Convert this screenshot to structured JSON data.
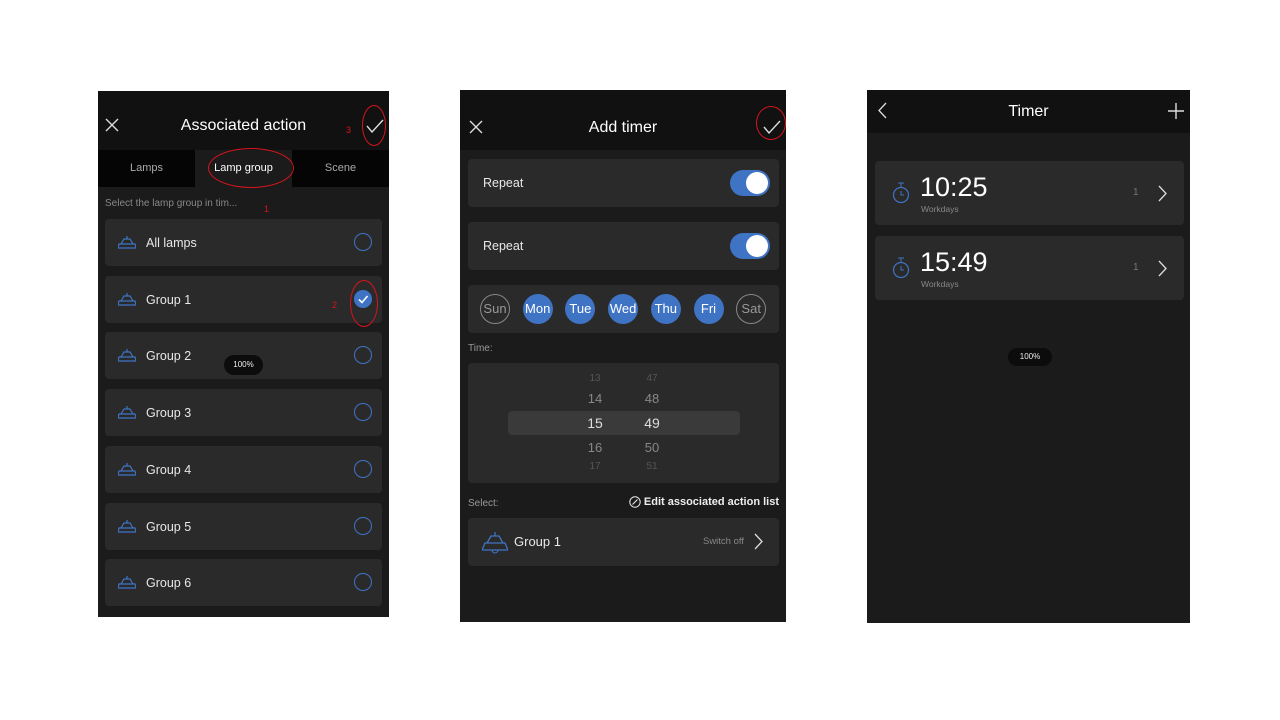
{
  "screen1": {
    "title": "Associated action",
    "tabs": [
      "Lamps",
      "Lamp group",
      "Scene"
    ],
    "selected_tab": "Lamp group",
    "hint": "Select the lamp group in tim...",
    "items": [
      {
        "label": "All lamps",
        "selected": false
      },
      {
        "label": "Group 1",
        "selected": true
      },
      {
        "label": "Group 2",
        "selected": false
      },
      {
        "label": "Group 3",
        "selected": false
      },
      {
        "label": "Group 4",
        "selected": false
      },
      {
        "label": "Group 5",
        "selected": false
      },
      {
        "label": "Group 6",
        "selected": false
      }
    ],
    "toast": "100%",
    "annotations": [
      "1",
      "2",
      "3"
    ]
  },
  "screen2": {
    "title": "Add timer",
    "toggles": [
      {
        "label": "Repeat",
        "on": true
      },
      {
        "label": "Repeat",
        "on": true
      }
    ],
    "days": [
      {
        "d": "Sun",
        "on": false
      },
      {
        "d": "Mon",
        "on": true
      },
      {
        "d": "Tue",
        "on": true
      },
      {
        "d": "Wed",
        "on": true
      },
      {
        "d": "Thu",
        "on": true
      },
      {
        "d": "Fri",
        "on": true
      },
      {
        "d": "Sat",
        "on": false
      }
    ],
    "time_label": "Time:",
    "hours": [
      "13",
      "14",
      "15",
      "16",
      "17"
    ],
    "minutes": [
      "47",
      "48",
      "49",
      "50",
      "51"
    ],
    "select_label": "Select:",
    "edit_link": "Edit associated action list",
    "group": {
      "label": "Group 1",
      "action": "Switch off"
    }
  },
  "screen3": {
    "title": "Timer",
    "timers": [
      {
        "time": "10:25",
        "repeat": "Workdays",
        "count": "1"
      },
      {
        "time": "15:49",
        "repeat": "Workdays",
        "count": "1"
      }
    ],
    "toast": "100%"
  },
  "colors": {
    "accent": "#3f74c4",
    "annotation": "#d8141c",
    "background": "#1b1b1b",
    "card": "#2a2a2a"
  }
}
